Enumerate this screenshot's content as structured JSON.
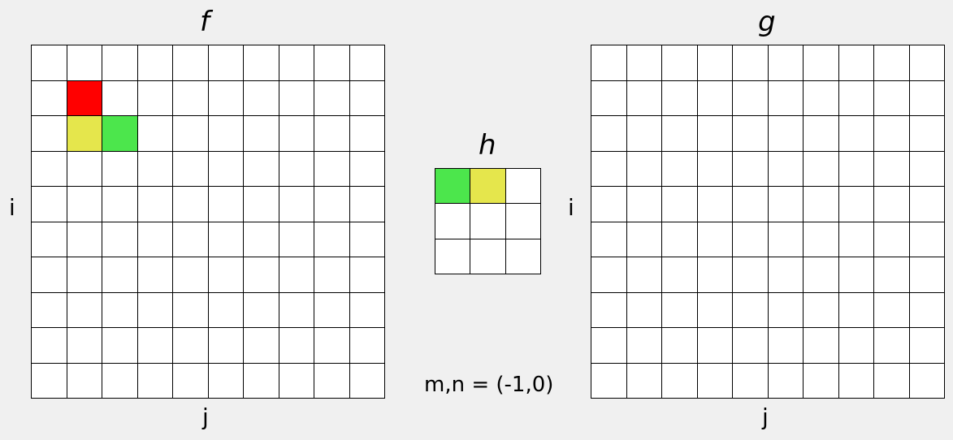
{
  "panels": {
    "f": {
      "title": "f",
      "row_label": "i",
      "col_label": "j",
      "rows": 10,
      "cols": 10,
      "highlights": [
        {
          "row": 1,
          "col": 1,
          "color": "#ff0000"
        },
        {
          "row": 2,
          "col": 1,
          "color": "#e5e64c"
        },
        {
          "row": 2,
          "col": 2,
          "color": "#4ce64c"
        }
      ]
    },
    "h": {
      "title": "h",
      "rows": 3,
      "cols": 3,
      "highlights": [
        {
          "row": 0,
          "col": 0,
          "color": "#4ce64c"
        },
        {
          "row": 0,
          "col": 1,
          "color": "#e5e64c"
        }
      ]
    },
    "g": {
      "title": "g",
      "row_label": "i",
      "col_label": "j",
      "rows": 10,
      "cols": 10,
      "highlights": []
    }
  },
  "offset_caption": "m,n = (-1,0)",
  "colors": {
    "background": "#f0f0f0",
    "cell": "#ffffff",
    "grid_line": "#000000"
  }
}
